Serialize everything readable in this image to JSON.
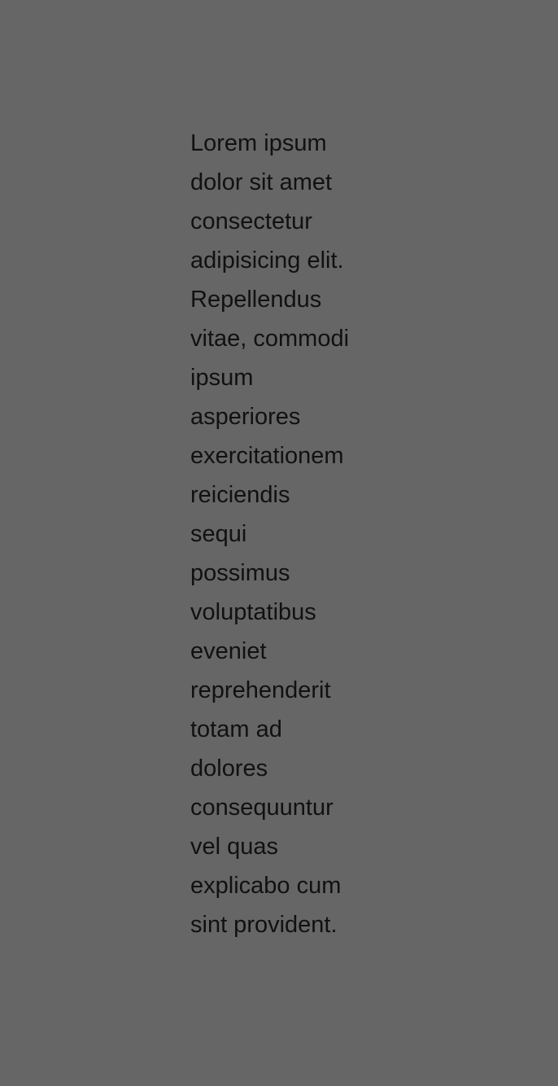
{
  "content": {
    "lines": [
      "Lorem ipsum",
      "dolor sit amet",
      "consectetur",
      "adipisicing elit.",
      "Repellendus",
      "vitae, commodi",
      "ipsum",
      "asperiores",
      "exercitationem",
      "reiciendis",
      "sequi",
      "possimus",
      "voluptatibus",
      "eveniet",
      "reprehenderit",
      "totam ad",
      "dolores",
      "consequuntur",
      "vel quas",
      "explicabo cum",
      "sint provident."
    ]
  },
  "colors": {
    "background": "#666666",
    "text": "#111111"
  }
}
